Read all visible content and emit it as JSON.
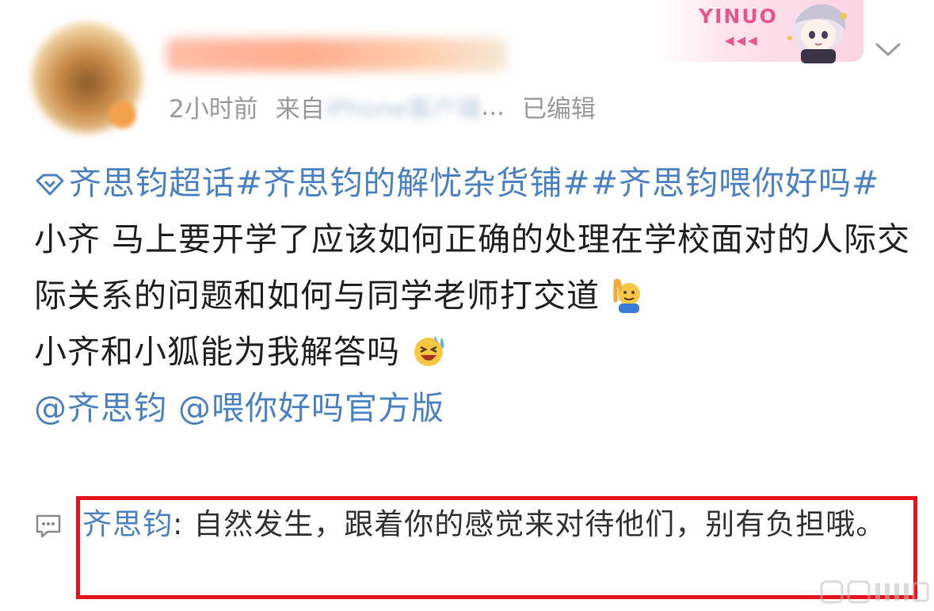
{
  "header": {
    "meta_time": "2小时前",
    "meta_from": "来自",
    "meta_source_blurred": "iPhone客户端",
    "meta_ellipsis": "...",
    "meta_edited": "已编辑",
    "decoration_text": "YINUO",
    "decoration_arrows": "◀◀◀"
  },
  "post": {
    "topic_links": "齐思钧超话#齐思钧的解忧杂货铺##齐思钧喂你好吗#",
    "body_line_1": "小齐 马上要开学了应该如何正确的处理在学校面对的人际交际关系的问题和如何与同学老师打交道",
    "body_line_2": "小齐和小狐能为我解答吗",
    "mention_1": "@齐思钧",
    "mention_2": "@喂你好吗官方版"
  },
  "comment": {
    "author": "齐思钧",
    "separator": ": ",
    "text": "自然发生，跟着你的感觉来对待他们，别有负担哦。"
  },
  "icons": {
    "super_topic": "diamond-icon",
    "emoji_1": "raising-hand-emoji",
    "emoji_2": "laughing-tears-emoji",
    "comment": "comment-bubble-icon",
    "menu": "chevron-down-icon"
  },
  "colors": {
    "link": "#4a82c3",
    "highlight_border": "#e4141b",
    "meta_gray": "#9a9a9a"
  }
}
